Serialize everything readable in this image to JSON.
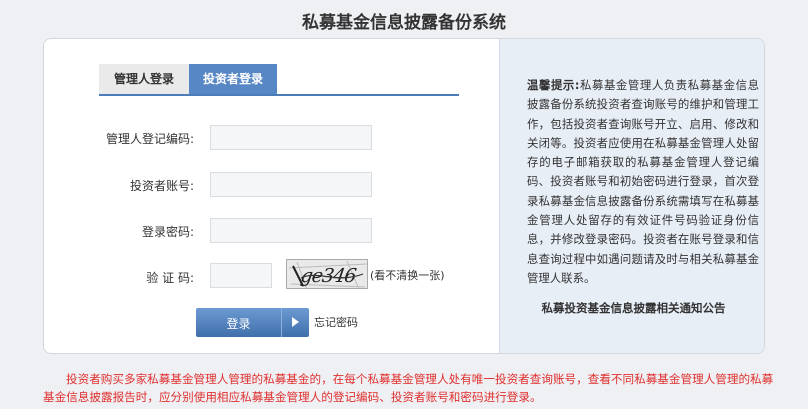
{
  "page": {
    "title": "私募基金信息披露备份系统"
  },
  "tabs": [
    {
      "label": "管理人登录",
      "active": false
    },
    {
      "label": "投资者登录",
      "active": true
    }
  ],
  "form": {
    "manager_code_label": "管理人登记编码:",
    "manager_code_value": "",
    "account_label": "投资者账号:",
    "account_value": "",
    "password_label": "登录密码:",
    "password_value": "",
    "captcha_label": "验 证 码:",
    "captcha_value": "",
    "captcha_image_text": "ge346",
    "refresh_label": "(看不清换一张)",
    "login_label": "登录",
    "forgot_label": "忘记密码"
  },
  "tips": {
    "heading": "温馨提示:",
    "body": "私募基金管理人负责私募基金信息披露备份系统投资者查询账号的维护和管理工作，包括投资者查询账号开立、启用、修改和关闭等。投资者应使用在私募基金管理人处留存的电子邮箱获取的私募基金管理人登记编码、投资者账号和初始密码进行登录，首次登录私募基金信息披露备份系统需填写在私募基金管理人处留存的有效证件号码验证身份信息，并修改登录密码。投资者在账号登录和信息查询过程中如遇问题请及时与相关私募基金管理人联系。",
    "notice_link": "私募投资基金信息披露相关通知公告"
  },
  "footer": {
    "note": "投资者购买多家私募基金管理人管理的私募基金的，在每个私募基金管理人处有唯一投资者查询账号，查看不同私募基金管理人管理的私募基金信息披露报告时，应分别使用相应私募基金管理人的登记编码、投资者账号和密码进行登录。"
  },
  "colors": {
    "active_tab": "#5787c4",
    "button": "#4a7ab8",
    "footer_text": "#e0302f",
    "info_panel": "#e8eef6"
  }
}
